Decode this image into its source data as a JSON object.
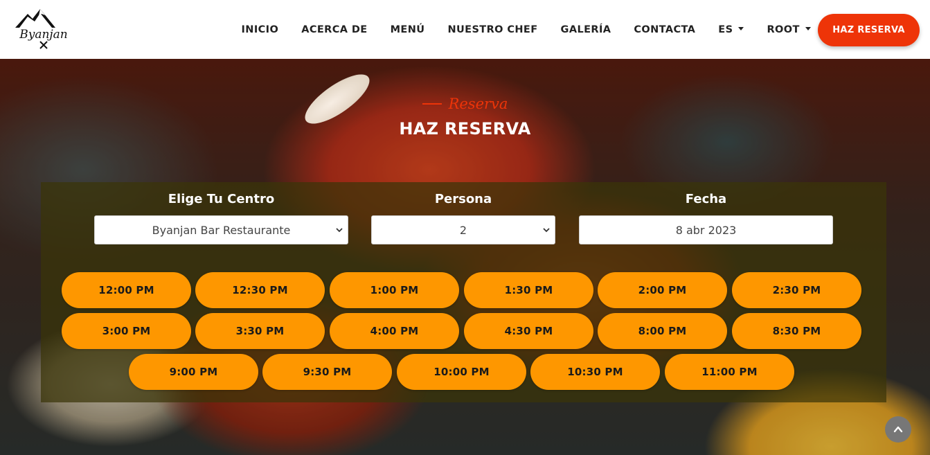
{
  "brand": {
    "logo_text": "Byanjan"
  },
  "nav": {
    "items": [
      {
        "label": "INICIO"
      },
      {
        "label": "ACERCA DE"
      },
      {
        "label": "MENÚ"
      },
      {
        "label": "NUESTRO CHEF"
      },
      {
        "label": "GALERÍA"
      },
      {
        "label": "CONTACTA"
      },
      {
        "label": "ES",
        "dropdown": true
      },
      {
        "label": "ROOT",
        "dropdown": true
      }
    ],
    "cta_label": "HAZ RESERVA"
  },
  "section": {
    "subtitle": "Reserva",
    "title": "HAZ RESERVA"
  },
  "form": {
    "center_label": "Elige Tu Centro",
    "center_value": "Byanjan Bar Restaurante",
    "persons_label": "Persona",
    "persons_value": "2",
    "date_label": "Fecha",
    "date_value": "8 abr 2023"
  },
  "time_slots": [
    [
      "12:00 PM",
      "12:30 PM",
      "1:00 PM",
      "1:30 PM",
      "2:00 PM",
      "2:30 PM"
    ],
    [
      "3:00 PM",
      "3:30 PM",
      "4:00 PM",
      "4:30 PM",
      "8:00 PM",
      "8:30 PM"
    ],
    [
      "9:00 PM",
      "9:30 PM",
      "10:00 PM",
      "10:30 PM",
      "11:00 PM"
    ]
  ],
  "colors": {
    "accent": "#ee3408",
    "slot": "#fe9700",
    "panel": "#3a3408"
  },
  "icons": {
    "logo": "mountain-logo-icon",
    "scroll_top": "chevron-up-icon"
  }
}
